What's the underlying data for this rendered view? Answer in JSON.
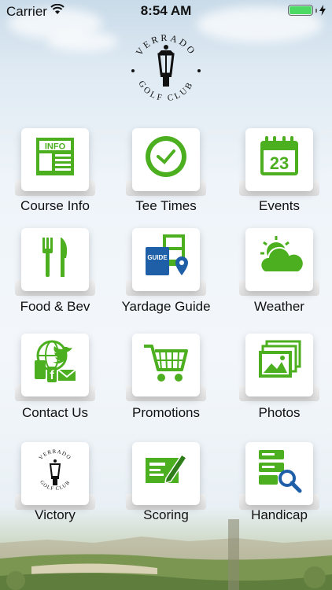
{
  "status_bar": {
    "carrier": "Carrier",
    "time": "8:54 AM",
    "battery_level": 1.0
  },
  "logo": {
    "top_text": "VERRADO",
    "bottom_text": "GOLF CLUB",
    "icon": "lantern-icon"
  },
  "menu": [
    {
      "label": "Course Info",
      "icon": "info-icon",
      "icon_text": "INFO"
    },
    {
      "label": "Tee Times",
      "icon": "clock-icon"
    },
    {
      "label": "Events",
      "icon": "calendar-icon",
      "icon_text": "23"
    },
    {
      "label": "Food & Bev",
      "icon": "fork-knife-icon"
    },
    {
      "label": "Yardage Guide",
      "icon": "guide-map-icon",
      "icon_text": "GUIDE"
    },
    {
      "label": "Weather",
      "icon": "weather-icon"
    },
    {
      "label": "Contact Us",
      "icon": "contact-icon"
    },
    {
      "label": "Promotions",
      "icon": "cart-icon"
    },
    {
      "label": "Photos",
      "icon": "photos-icon"
    },
    {
      "label": "Victory",
      "icon": "club-logo-icon",
      "icon_text_top": "VERRADO",
      "icon_text_bottom": "GOLF CLUB"
    },
    {
      "label": "Scoring",
      "icon": "scorecard-icon"
    },
    {
      "label": "Handicap",
      "icon": "handicap-icon"
    }
  ],
  "colors": {
    "icon_green": "#4caf1f",
    "dark_green": "#2e7d1a",
    "blue": "#1e5fa8"
  }
}
